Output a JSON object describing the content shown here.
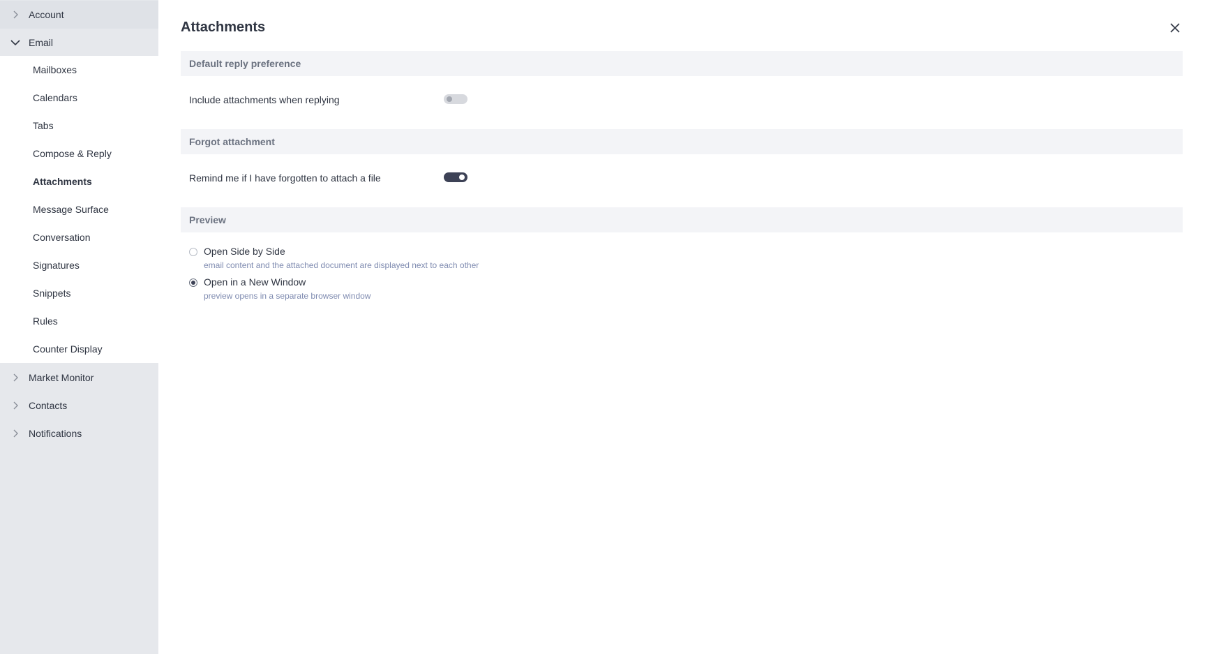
{
  "sidebar": {
    "account_label": "Account",
    "email_label": "Email",
    "email_items": [
      "Mailboxes",
      "Calendars",
      "Tabs",
      "Compose & Reply",
      "Attachments",
      "Message Surface",
      "Conversation",
      "Signatures",
      "Snippets",
      "Rules",
      "Counter Display"
    ],
    "selected_item": "Attachments",
    "market_monitor_label": "Market Monitor",
    "contacts_label": "Contacts",
    "notifications_label": "Notifications"
  },
  "main": {
    "title": "Attachments",
    "sections": {
      "reply": {
        "header": "Default reply preference",
        "setting_label": "Include attachments when replying",
        "toggle_on": false
      },
      "forgot": {
        "header": "Forgot attachment",
        "setting_label": "Remind me if I have forgotten to attach a file",
        "toggle_on": true
      },
      "preview": {
        "header": "Preview",
        "options": [
          {
            "label": "Open Side by Side",
            "description": "email content and the attached document are displayed next to each other",
            "checked": false
          },
          {
            "label": "Open in a New Window",
            "description": "preview opens in a separate browser window",
            "checked": true
          }
        ]
      }
    }
  },
  "icons": {
    "close": "close-icon",
    "expand": "chevron-right-icon",
    "collapse": "chevron-down-icon"
  }
}
